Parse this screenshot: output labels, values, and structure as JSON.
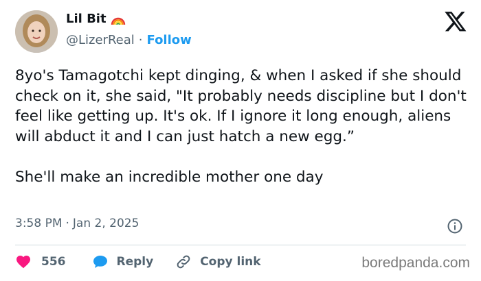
{
  "author": {
    "display_name": "Lil Bit",
    "handle": "@LizerReal",
    "follow_label": "Follow",
    "separator": "·"
  },
  "tweet": {
    "text": "8yo's Tamagotchi kept dinging, & when I asked if she should check on it, she said, \"It probably needs discipline but I don't feel like getting up. It's ok. If I ignore it long enough, aliens will abduct it and I can just hatch a new egg.”\n\nShe'll make an incredible mother one day",
    "time": "3:58 PM",
    "date": "Jan 2, 2025"
  },
  "actions": {
    "likes": "556",
    "reply_label": "Reply",
    "copy_label": "Copy link"
  },
  "icons": {
    "brand": "x-logo-icon",
    "badge": "rainbow-icon",
    "info": "info-icon",
    "like": "heart-icon",
    "reply": "chat-bubble-icon",
    "copy": "link-icon"
  },
  "colors": {
    "accent": "#1d9bf0",
    "like": "#f91880",
    "text": "#0f1419",
    "secondary": "#536471"
  },
  "watermark": "boredpanda.com"
}
